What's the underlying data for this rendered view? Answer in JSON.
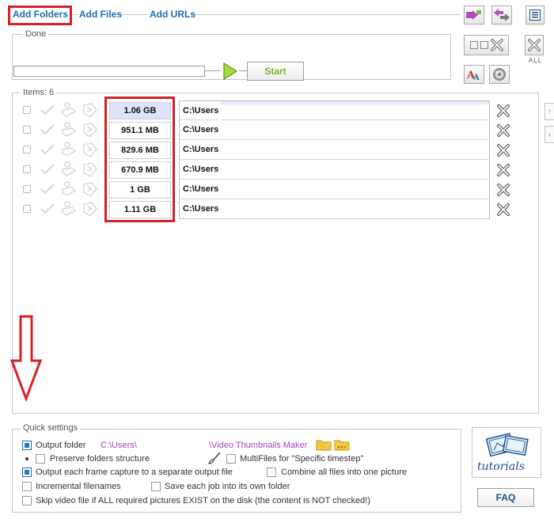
{
  "toolbar": {
    "add_folders": "Add Folders",
    "add_files": "Add Files",
    "add_urls": "Add URLs"
  },
  "status": {
    "group_label": "Done",
    "start_label": "Start",
    "all_label": "ALL"
  },
  "items": {
    "header": "Items: 6",
    "rows": [
      {
        "size": "1.06 GB",
        "path": "C:\\Users",
        "selected": true
      },
      {
        "size": "951.1 MB",
        "path": "C:\\Users",
        "selected": false
      },
      {
        "size": "829.6 MB",
        "path": "C:\\Users",
        "selected": false
      },
      {
        "size": "670.9 MB",
        "path": "C:\\Users",
        "selected": false
      },
      {
        "size": "1 GB",
        "path": "C:\\Users",
        "selected": false
      },
      {
        "size": "1.11 GB",
        "path": "C:\\Users",
        "selected": false
      }
    ]
  },
  "quick_settings": {
    "label": "Quick settings",
    "output_folder_label": "Output folder",
    "output_folder_path_start": "C:\\Users\\",
    "output_folder_path_end": "\\Video Thumbnails Maker",
    "preserve_structure": "Preserve folders structure",
    "multifiles": "MultiFiles for \"Specific timestep\"",
    "each_frame": "Output each frame capture to a separate output file",
    "combine": "Combine all files into one picture",
    "incremental": "Incremental filenames",
    "own_folder": "Save each job into its own folder",
    "skip_existing": "Skip video file if ALL required pictures EXIST on the disk (the content is NOT checked!)"
  },
  "help": {
    "tutorials": "tutorials",
    "faq": "FAQ"
  },
  "colors": {
    "accent_link": "#1e6fa8",
    "highlight_red": "#d62027",
    "start_green": "#76b41f",
    "path_purple": "#a53fbc"
  }
}
